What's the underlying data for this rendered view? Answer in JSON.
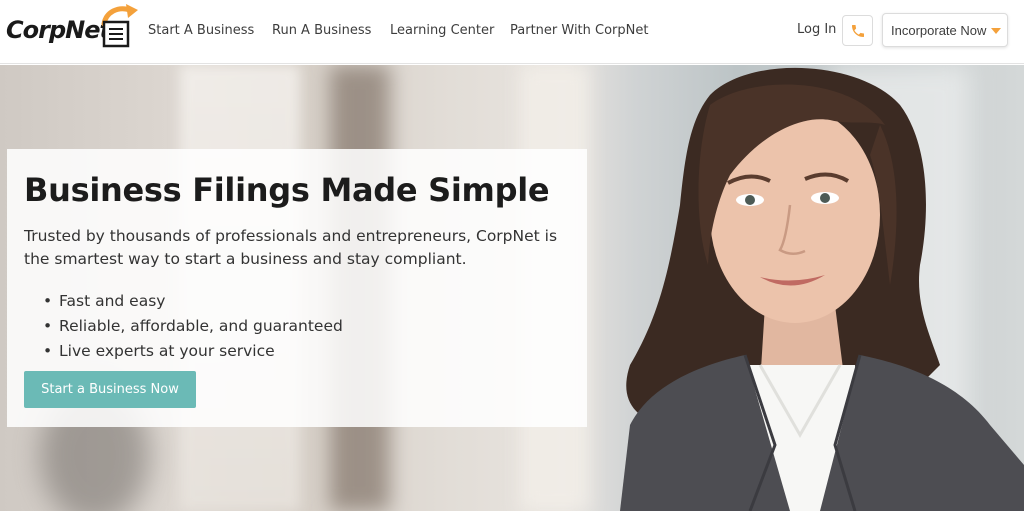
{
  "brand": {
    "logo_text": "CorpNet",
    "accent_color": "#f4a13b",
    "cta_color": "#6bbab6"
  },
  "nav": {
    "links": [
      "Start A Business",
      "Run A Business",
      "Learning Center",
      "Partner With CorpNet"
    ],
    "login_label": "Log In",
    "phone_icon": "phone-icon",
    "incorporate_label": "Incorporate Now",
    "incorporate_icon": "caret-down-icon"
  },
  "hero": {
    "headline": "Business Filings Made Simple",
    "subtext": "Trusted by thousands of professionals and entrepreneurs, CorpNet is the smartest way to start a business and stay compliant.",
    "bullets": [
      "Fast and easy",
      "Reliable, affordable, and guaranteed",
      "Live experts at your service"
    ],
    "cta_label": "Start a Business Now"
  }
}
